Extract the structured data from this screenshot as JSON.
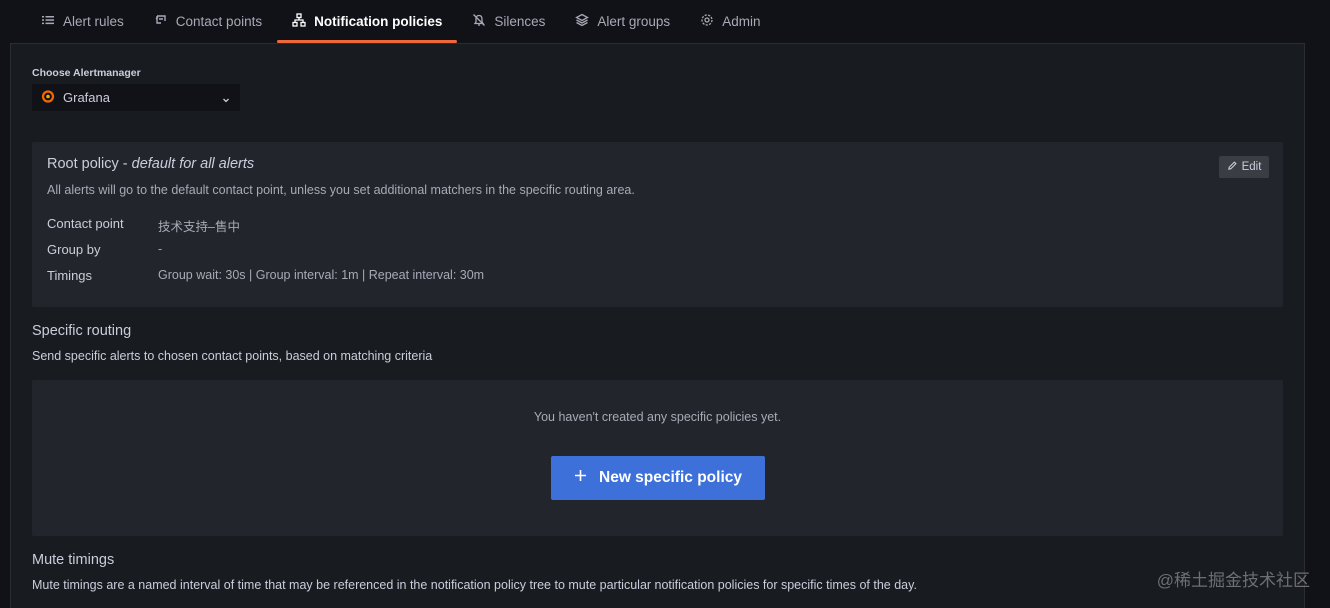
{
  "tabs": [
    {
      "label": "Alert rules",
      "icon": "list-icon"
    },
    {
      "label": "Contact points",
      "icon": "comment-icon"
    },
    {
      "label": "Notification policies",
      "icon": "sitemap-icon",
      "active": true
    },
    {
      "label": "Silences",
      "icon": "bell-slash-icon"
    },
    {
      "label": "Alert groups",
      "icon": "layer-group-icon"
    },
    {
      "label": "Admin",
      "icon": "cog-icon"
    }
  ],
  "alertmanager": {
    "label": "Choose Alertmanager",
    "selected": "Grafana"
  },
  "root_policy": {
    "title_main": "Root policy - ",
    "title_em": "default for all alerts",
    "description": "All alerts will go to the default contact point, unless you set additional matchers in the specific routing area.",
    "edit_label": "Edit",
    "contact_point_label": "Contact point",
    "contact_point_value": "技术支持–售中",
    "group_by_label": "Group by",
    "group_by_value": "-",
    "timings_label": "Timings",
    "timings_value": "Group wait: 30s | Group interval: 1m | Repeat interval: 30m"
  },
  "specific_routing": {
    "title": "Specific routing",
    "description": "Send specific alerts to chosen contact points, based on matching criteria",
    "empty_text": "You haven't created any specific policies yet.",
    "new_button_label": "New specific policy"
  },
  "mute_timings": {
    "title": "Mute timings",
    "description": "Mute timings are a named interval of time that may be referenced in the notification policy tree to mute particular notification policies for specific times of the day."
  },
  "watermark": "@稀土掘金技术社区",
  "colors": {
    "accent_tab": "#f0683a",
    "primary_button": "#3d71d9",
    "background": "#111217",
    "panel": "#181b1f",
    "card": "#22252b"
  }
}
